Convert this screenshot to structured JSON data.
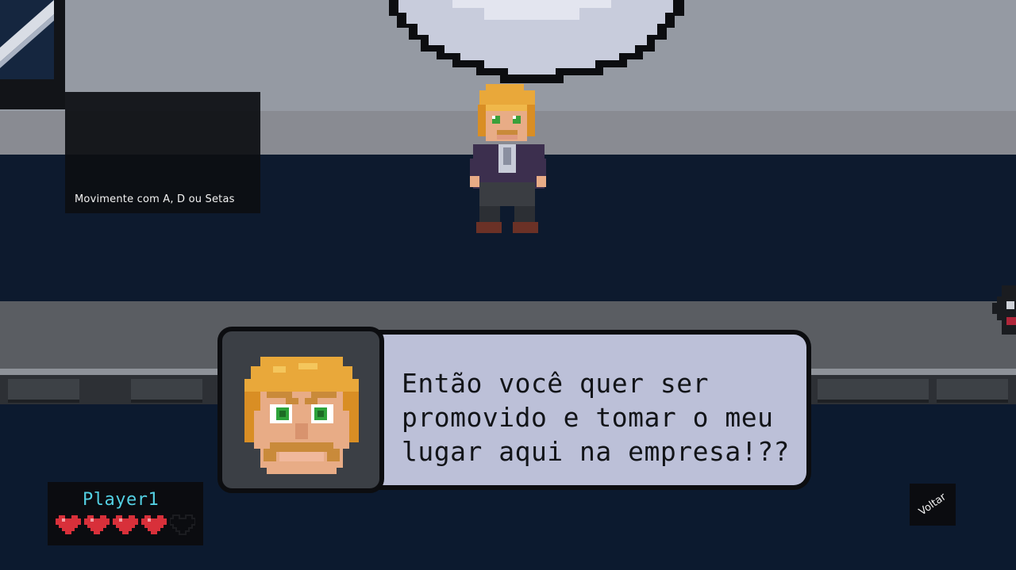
{
  "tutorial": {
    "text": "Movimente com A, D ou Setas"
  },
  "dialog": {
    "lines": [
      "Então você quer ser",
      "promovido e tomar o meu",
      "lugar aqui na empresa!??"
    ]
  },
  "hud": {
    "player_name": "Player1",
    "hearts_total": 5,
    "hearts_filled": 4
  },
  "back_button": {
    "label": "Voltar"
  },
  "colors": {
    "dialog_bg": "#bcc0d8",
    "player_name": "#53d0e3",
    "heart_full": "#d8303a",
    "heart_empty": "#1b1c20"
  },
  "icons": {
    "portrait": "boss-portrait-icon",
    "heart": "heart-icon"
  }
}
